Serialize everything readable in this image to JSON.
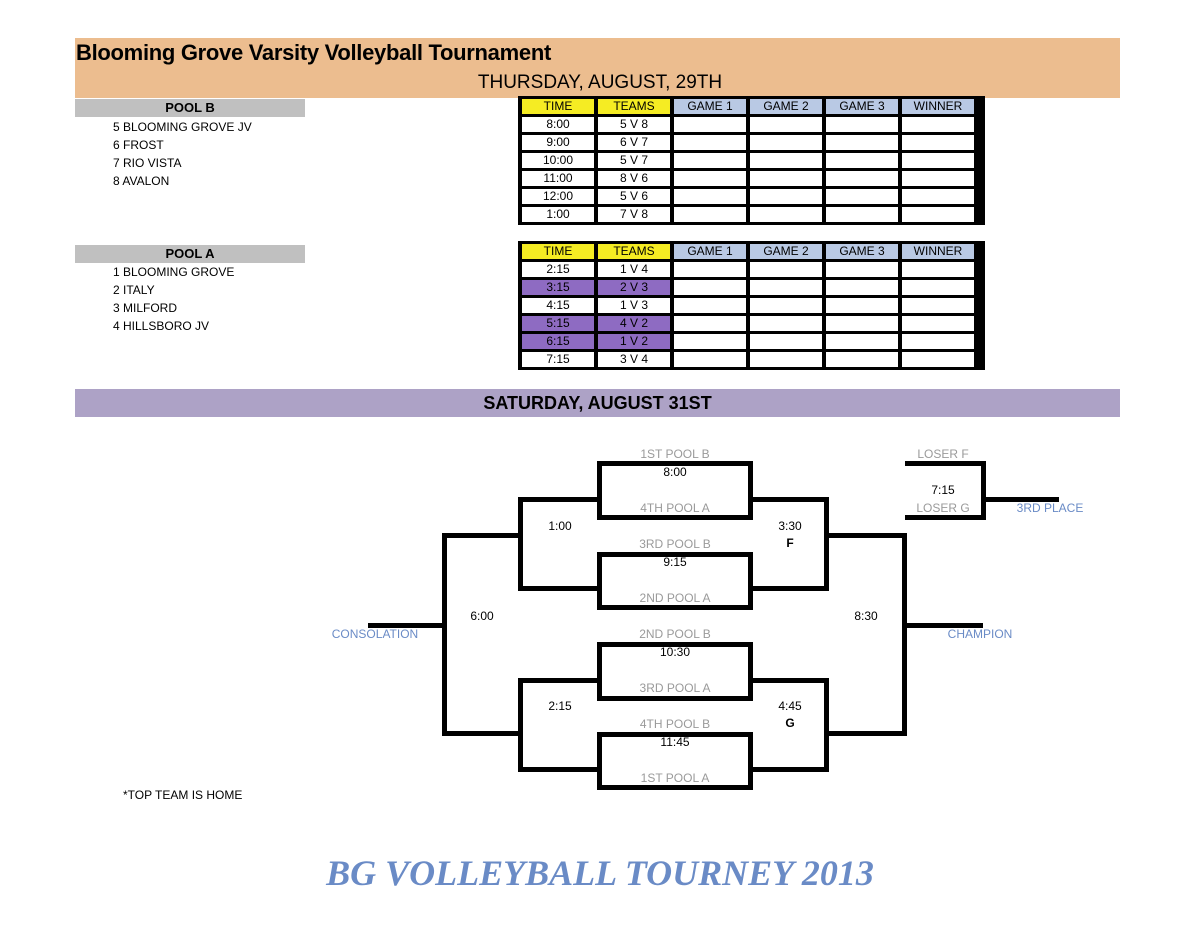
{
  "header": {
    "title": "Blooming Grove Varsity Volleyball Tournament",
    "day1": "THURSDAY, AUGUST, 29TH"
  },
  "pools": [
    {
      "name": "POOL B",
      "teams": [
        "5 BLOOMING GROVE JV",
        "6 FROST",
        "7 RIO VISTA",
        "8 AVALON"
      ]
    },
    {
      "name": "POOL A",
      "teams": [
        "1 BLOOMING GROVE",
        "2 ITALY",
        "3 MILFORD",
        "4 HILLSBORO JV"
      ]
    }
  ],
  "schedule_columns": [
    "TIME",
    "TEAMS",
    "GAME 1",
    "GAME 2",
    "GAME 3",
    "WINNER"
  ],
  "colors": {
    "header_band": "#ecbd8f",
    "pool_header": "#c0c0c0",
    "time_team_header": "#f5ec23",
    "game_header": "#b9c9e4",
    "highlight_row": "#8e6bc2",
    "saturday_band": "#ada2c6",
    "accent_blue": "#6a8bc6"
  },
  "schedules": [
    {
      "pool": "POOL B",
      "rows": [
        {
          "time": "8:00",
          "teams": "5 V 8",
          "game1": "",
          "game2": "",
          "game3": "",
          "winner": "",
          "highlight": false
        },
        {
          "time": "9:00",
          "teams": "6 V 7",
          "game1": "",
          "game2": "",
          "game3": "",
          "winner": "",
          "highlight": false
        },
        {
          "time": "10:00",
          "teams": "5 V 7",
          "game1": "",
          "game2": "",
          "game3": "",
          "winner": "",
          "highlight": false
        },
        {
          "time": "11:00",
          "teams": "8 V 6",
          "game1": "",
          "game2": "",
          "game3": "",
          "winner": "",
          "highlight": false
        },
        {
          "time": "12:00",
          "teams": "5 V 6",
          "game1": "",
          "game2": "",
          "game3": "",
          "winner": "",
          "highlight": false
        },
        {
          "time": "1:00",
          "teams": "7 V 8",
          "game1": "",
          "game2": "",
          "game3": "",
          "winner": "",
          "highlight": false
        }
      ]
    },
    {
      "pool": "POOL A",
      "rows": [
        {
          "time": "2:15",
          "teams": "1 V 4",
          "game1": "",
          "game2": "",
          "game3": "",
          "winner": "",
          "highlight": false
        },
        {
          "time": "3:15",
          "teams": "2 V 3",
          "game1": "",
          "game2": "",
          "game3": "",
          "winner": "",
          "highlight": true
        },
        {
          "time": "4:15",
          "teams": "1 V 3",
          "game1": "",
          "game2": "",
          "game3": "",
          "winner": "",
          "highlight": false
        },
        {
          "time": "5:15",
          "teams": "4 V 2",
          "game1": "",
          "game2": "",
          "game3": "",
          "winner": "",
          "highlight": true
        },
        {
          "time": "6:15",
          "teams": "1 V 2",
          "game1": "",
          "game2": "",
          "game3": "",
          "winner": "",
          "highlight": true
        },
        {
          "time": "7:15",
          "teams": "3 V 4",
          "game1": "",
          "game2": "",
          "game3": "",
          "winner": "",
          "highlight": false
        }
      ]
    }
  ],
  "day2": "SATURDAY, AUGUST 31ST",
  "bracket": {
    "round1": [
      {
        "top": "1ST POOL B",
        "time": "8:00",
        "bottom": "4TH POOL A"
      },
      {
        "top": "3RD POOL B",
        "time": "9:15",
        "bottom": "2ND POOL A"
      },
      {
        "top": "2ND POOL B",
        "time": "10:30",
        "bottom": "3RD POOL A"
      },
      {
        "top": "4TH POOL B",
        "time": "11:45",
        "bottom": "1ST POOL A"
      }
    ],
    "consolation_semis": [
      {
        "time": "1:00"
      },
      {
        "time": "2:15"
      }
    ],
    "semis": [
      {
        "time": "3:30",
        "game": "F"
      },
      {
        "time": "4:45",
        "game": "G"
      }
    ],
    "consolation_final": {
      "time": "6:00",
      "label": "CONSOLATION"
    },
    "final": {
      "time": "8:30",
      "label": "CHAMPION"
    },
    "third_place": {
      "top": "LOSER F",
      "time": "7:15",
      "bottom": "LOSER G",
      "label": "3RD PLACE"
    }
  },
  "note": "*TOP TEAM IS HOME",
  "footer": "BG VOLLEYBALL TOURNEY 2013"
}
